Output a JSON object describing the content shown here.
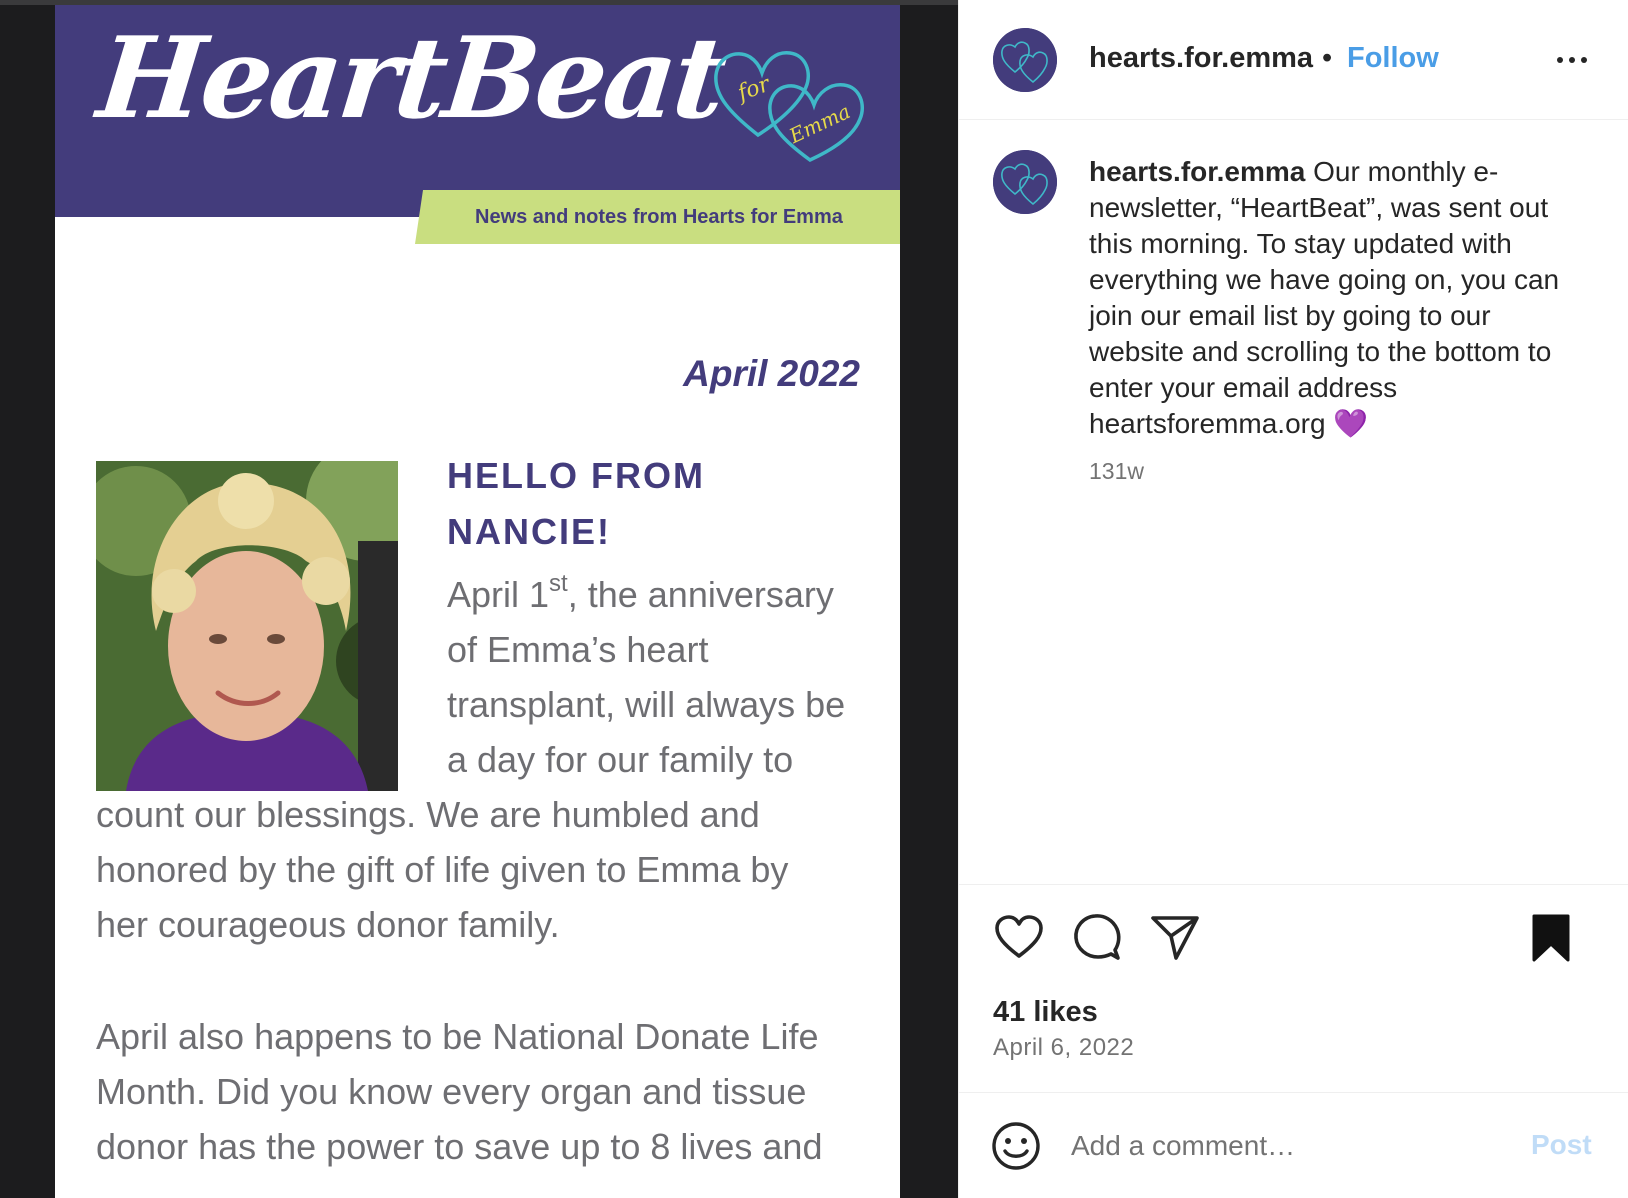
{
  "newsletter": {
    "title": "HeartBeat",
    "logo_text_1": "for",
    "logo_text_2": "Emma",
    "tagline": "News and notes from Hearts for Emma",
    "date": "April 2022",
    "heading_line_1": "HELLO FROM",
    "heading_line_2": "NANCIE!",
    "body_line_1_pre": "April 1",
    "body_line_1_sup": "st",
    "body_line_1_post": ", the anniversary",
    "body_lines": [
      "of Emma’s heart",
      "transplant, will always be",
      "a day for our family to",
      "count our blessings. We are humbled and",
      "honored by the gift of life given to Emma by",
      "her courageous donor family."
    ],
    "body_lines_2": [
      "April also happens to be National Donate Life",
      "Month. Did you know every organ and tissue",
      "donor has the power to save up to 8 lives and"
    ],
    "colors": {
      "banner": "#433c7c",
      "tagline_bg": "#c9de80",
      "heart_outline": "#3fb8c8",
      "script": "#e6d94a"
    }
  },
  "header": {
    "username": "hearts.for.emma",
    "separator": "•",
    "follow_label": "Follow",
    "more_icon": "more-horizontal-icon"
  },
  "caption": {
    "username": "hearts.for.emma",
    "text": "Our monthly e-newsletter, “HeartBeat”, was sent out this morning. To stay updated with everything we have going on, you can join our email list by going to our website and scrolling to the bottom to enter your email address heartsforemma.org 💜",
    "time": "131w"
  },
  "actions": {
    "icons": [
      "heart-icon",
      "comment-icon",
      "share-icon",
      "bookmark-icon"
    ],
    "likes": "41 likes",
    "date": "April 6, 2022"
  },
  "comment": {
    "placeholder": "Add a comment…",
    "post_label": "Post"
  }
}
